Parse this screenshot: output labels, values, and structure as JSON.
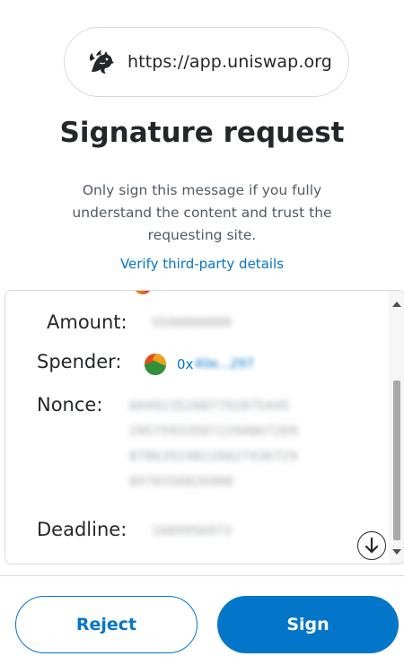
{
  "origin": {
    "icon": "uniswap-unicorn-icon",
    "url": "https://app.uniswap.org"
  },
  "title": "Signature request",
  "description": "Only sign this message if you fully understand the content and trust the requesting site.",
  "verify_link": "Verify third-party details",
  "message": {
    "amount": {
      "label": "Amount:",
      "value": "5500000000"
    },
    "spender": {
      "label": "Spender:",
      "address_prefix": "0x",
      "address_rest": "40e...297"
    },
    "nonce": {
      "label": "Nonce:",
      "lines": [
        "60492352087792075445",
        "29575933507239486726​9",
        "87863924822682743672​9",
        "8970356826900"
      ]
    },
    "deadline": {
      "label": "Deadline:",
      "value": "1689956973"
    }
  },
  "buttons": {
    "reject": "Reject",
    "sign": "Sign"
  },
  "colors": {
    "accent": "#0376c9",
    "text": "#24272a",
    "muted": "#535a61",
    "border": "#d6d9dc"
  }
}
